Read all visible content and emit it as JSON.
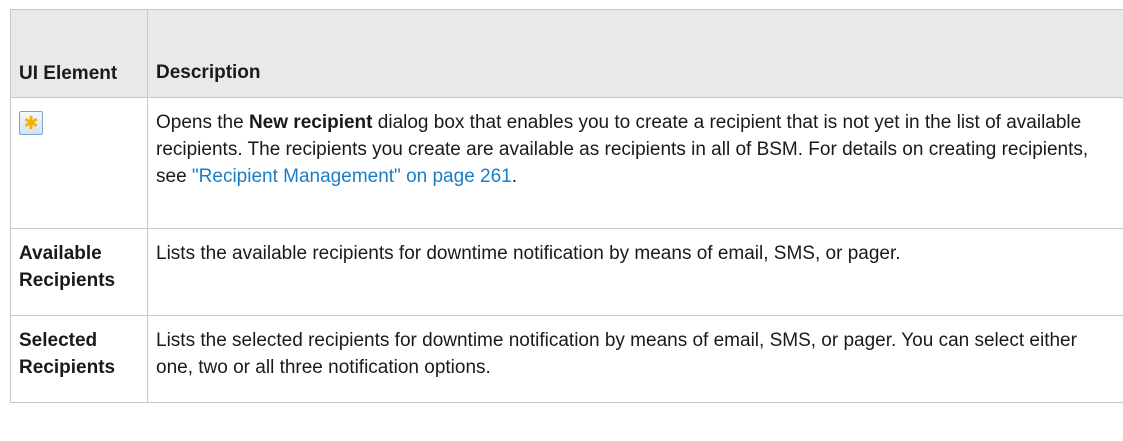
{
  "header": {
    "col1": "UI Element",
    "col2": "Description"
  },
  "rows": [
    {
      "icon": "new-recipient-icon",
      "desc": {
        "prefix": "Opens the ",
        "bold": "New recipient",
        "middle": " dialog box that enables you to create a recipient that is not yet in the list of available recipients. The recipients you create are available as recipients in all of BSM. For details on creating recipients, see ",
        "link": "\"Recipient Management\" on page 261",
        "suffix": "."
      }
    },
    {
      "name": "Available Recipients",
      "desc": "Lists the available recipients for downtime notification by means of email, SMS, or pager."
    },
    {
      "name": "Selected Recipients",
      "desc": "Lists the selected recipients for downtime notification by means of email, SMS, or pager. You can select either one, two or all three notification options."
    }
  ],
  "colors": {
    "header_bg": "#e9e9e9",
    "border": "#c8c8c8",
    "link": "#1a7ec7",
    "icon_star": "#f0b400"
  }
}
